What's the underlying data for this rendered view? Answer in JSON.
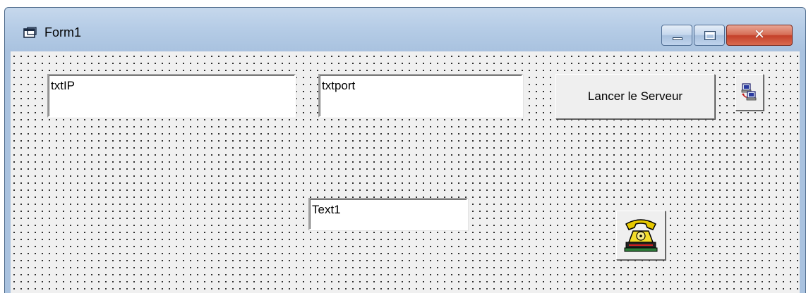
{
  "window": {
    "title": "Form1",
    "icon": "form-icon",
    "controls": {
      "minimize_icon": "minimize-icon",
      "maximize_icon": "maximize-icon",
      "close_glyph": "✕"
    }
  },
  "form": {
    "txtIP": {
      "value": "txtIP"
    },
    "txtport": {
      "value": "txtport"
    },
    "text1": {
      "value": "Text1"
    },
    "launch_button": {
      "label": "Lancer le Serveur"
    },
    "network_button": {
      "icon": "network-computers-icon"
    },
    "phone_button": {
      "icon": "telephone-icon"
    }
  },
  "colors": {
    "client_background": "#f0f0f0",
    "grid_dots": "#000000",
    "title_gradient_top": "#c6d8ec",
    "close_button": "#c4402a"
  }
}
